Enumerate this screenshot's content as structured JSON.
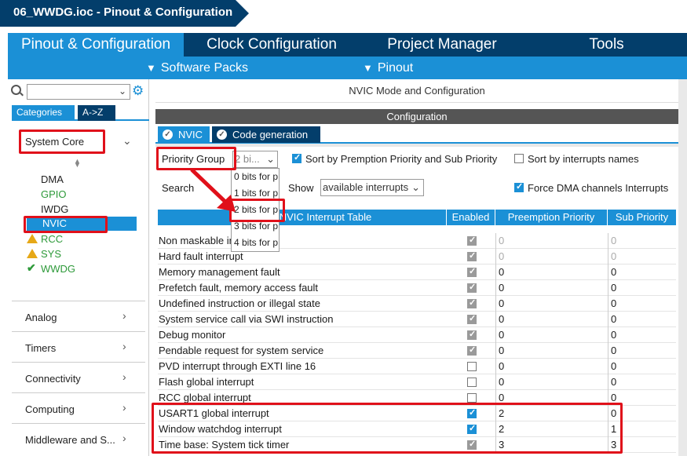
{
  "breadcrumb": {
    "title": "06_WWDG.ioc - Pinout & Configuration"
  },
  "main_tabs": [
    "Pinout & Configuration",
    "Clock Configuration",
    "Project Manager",
    "Tools"
  ],
  "sub_bar": {
    "software_packs": "Software Packs",
    "pinout": "Pinout"
  },
  "left": {
    "category_tabs": [
      "Categories",
      "A->Z"
    ],
    "system_core": "System Core",
    "items": [
      "DMA",
      "GPIO",
      "IWDG",
      "NVIC",
      "RCC",
      "SYS",
      "WWDG"
    ],
    "groups": [
      "Analog",
      "Timers",
      "Connectivity",
      "Computing",
      "Middleware and S..."
    ]
  },
  "right": {
    "panel_title": "NVIC Mode and Configuration",
    "config_label": "Configuration",
    "tabs": [
      "NVIC",
      "Code generation"
    ],
    "priority_group_label": "Priority Group",
    "priority_group_value": "2 bi...",
    "sort_preemption": "Sort by Premption Priority and Sub Priority",
    "sort_names": "Sort by interrupts names",
    "search_label": "Search",
    "show_label": "Show",
    "show_value": "available interrupts",
    "force_dma": "Force DMA channels Interrupts",
    "dropdown_options": [
      "0 bits for p",
      "1 bits for p",
      "2 bits for p",
      "3 bits for p",
      "4 bits for p"
    ],
    "table_headers": [
      "NVIC Interrupt Table",
      "Enabled",
      "Preemption Priority",
      "Sub Priority"
    ],
    "rows": [
      {
        "name": "Non maskable int",
        "enabled": true,
        "pp": "0",
        "sp": "0",
        "fixed": true
      },
      {
        "name": "Hard fault interrupt",
        "enabled": true,
        "pp": "0",
        "sp": "0",
        "fixed": true
      },
      {
        "name": "Memory management fault",
        "enabled": true,
        "pp": "0",
        "sp": "0",
        "fixed": false
      },
      {
        "name": "Prefetch fault, memory access fault",
        "enabled": true,
        "pp": "0",
        "sp": "0",
        "fixed": false
      },
      {
        "name": "Undefined instruction or illegal state",
        "enabled": true,
        "pp": "0",
        "sp": "0",
        "fixed": false
      },
      {
        "name": "System service call via SWI instruction",
        "enabled": true,
        "pp": "0",
        "sp": "0",
        "fixed": false
      },
      {
        "name": "Debug monitor",
        "enabled": true,
        "pp": "0",
        "sp": "0",
        "fixed": false
      },
      {
        "name": "Pendable request for system service",
        "enabled": true,
        "pp": "0",
        "sp": "0",
        "fixed": false
      },
      {
        "name": "PVD interrupt through EXTI line 16",
        "enabled": false,
        "pp": "0",
        "sp": "0",
        "fixed": false
      },
      {
        "name": "Flash global interrupt",
        "enabled": false,
        "pp": "0",
        "sp": "0",
        "fixed": false
      },
      {
        "name": "RCC global interrupt",
        "enabled": false,
        "pp": "0",
        "sp": "0",
        "fixed": false
      },
      {
        "name": "USART1 global interrupt",
        "enabled": true,
        "pp": "2",
        "sp": "0",
        "fixed": false
      },
      {
        "name": "Window watchdog interrupt",
        "enabled": true,
        "pp": "2",
        "sp": "1",
        "fixed": false
      },
      {
        "name": "Time base: System tick timer",
        "enabled": true,
        "pp": "3",
        "sp": "3",
        "fixed": false
      }
    ]
  },
  "colors": {
    "navy": "#033e6b",
    "blue": "#1b90d6",
    "green": "#2e9a3a",
    "red": "#e0101a"
  }
}
